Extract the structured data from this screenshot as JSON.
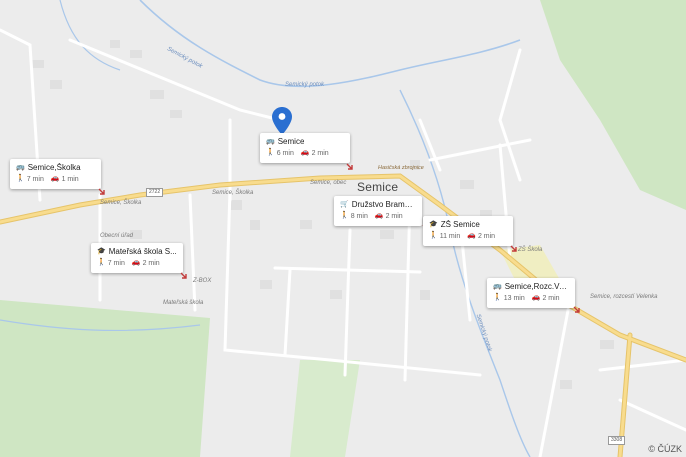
{
  "map": {
    "town_label": "Semice",
    "copyright": "© ČÚZK",
    "road_numbers": [
      "2722",
      "3308"
    ],
    "creeks": [
      "Semický potok",
      "Semický potok",
      "Semický potok"
    ],
    "place_labels": {
      "bus_stop_west": "Semice, Školka",
      "bus_stop_west2": "Semice, Školka",
      "bus_stop_centre": "Semice, obec",
      "obecni_urad": "Obecní úřad",
      "fire_station": "Hasičská zbrojnice",
      "school": "ZŠ Škola",
      "kindergarten": "Mateřská škola",
      "zbox": "Z-BOX",
      "rozc": "Semice, rozcestí Velenka"
    },
    "colors": {
      "background": "#ececec",
      "road": "#ffffff",
      "main_road": "#f5d47a",
      "water": "#a9c7ea",
      "green": "#cfe6c3",
      "pin": "#2a6fd1"
    }
  },
  "cards": [
    {
      "name": "Semice",
      "icon": "bus-icon",
      "walk": "6 min",
      "car": "2 min"
    },
    {
      "name": "Semice,Školka",
      "icon": "bus-icon",
      "walk": "7 min",
      "car": "1 min"
    },
    {
      "name": "Družstvo Bramko ...",
      "icon": "cart-icon",
      "walk": "8 min",
      "car": "2 min"
    },
    {
      "name": "ZŠ Semice",
      "icon": "school-icon",
      "walk": "11 min",
      "car": "2 min"
    },
    {
      "name": "Mateřská škola S...",
      "icon": "school-icon",
      "walk": "7 min",
      "car": "2 min"
    },
    {
      "name": "Semice,Rozc.Vele...",
      "icon": "bus-icon",
      "walk": "13 min",
      "car": "2 min"
    }
  ]
}
